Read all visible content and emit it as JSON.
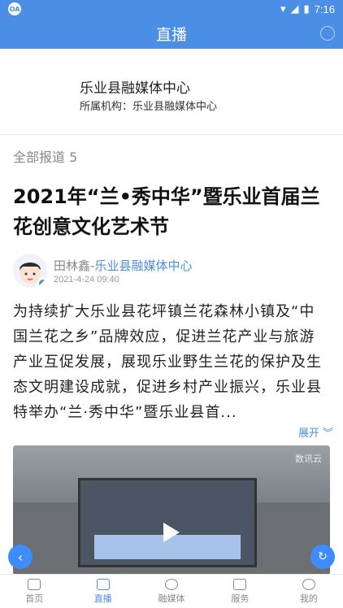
{
  "status_bar": {
    "time": "7:16",
    "app_icon": "OA"
  },
  "header": {
    "title": "直播"
  },
  "org_card": {
    "name": "乐业县融媒体中心",
    "affiliation": "所属机构：乐业县融媒体中心"
  },
  "list": {
    "count_label": "全部报道 5"
  },
  "article": {
    "title": "2021年“兰•秀中华”暨乐业首届兰花创意文化艺术节",
    "author_name": "田林鑫",
    "separator": "-",
    "author_org": "乐业县融媒体中心",
    "date": "2021-4-24 09:40",
    "body": "为持续扩大乐业县花坪镇兰花森林小镇及“中国兰花之乡”品牌效应，促进兰花产业与旅游产业互促发展，展现乐业野生兰花的保护及生态文明建设成就，促进乡村产业振兴，乐业县特举办“兰·秀中华”暨乐业县首...",
    "expand_label": "展开",
    "video_watermark": "数讯云"
  },
  "tabbar": {
    "items": [
      {
        "label": "首页",
        "icon": "home-icon"
      },
      {
        "label": "直播",
        "icon": "live-icon"
      },
      {
        "label": "融媒体",
        "icon": "media-icon"
      },
      {
        "label": "服务",
        "icon": "grid-icon"
      },
      {
        "label": "我的",
        "icon": "profile-icon"
      }
    ],
    "active": "直播"
  },
  "colors": {
    "primary": "#4a8ee6",
    "fab": "#3d8dff"
  }
}
